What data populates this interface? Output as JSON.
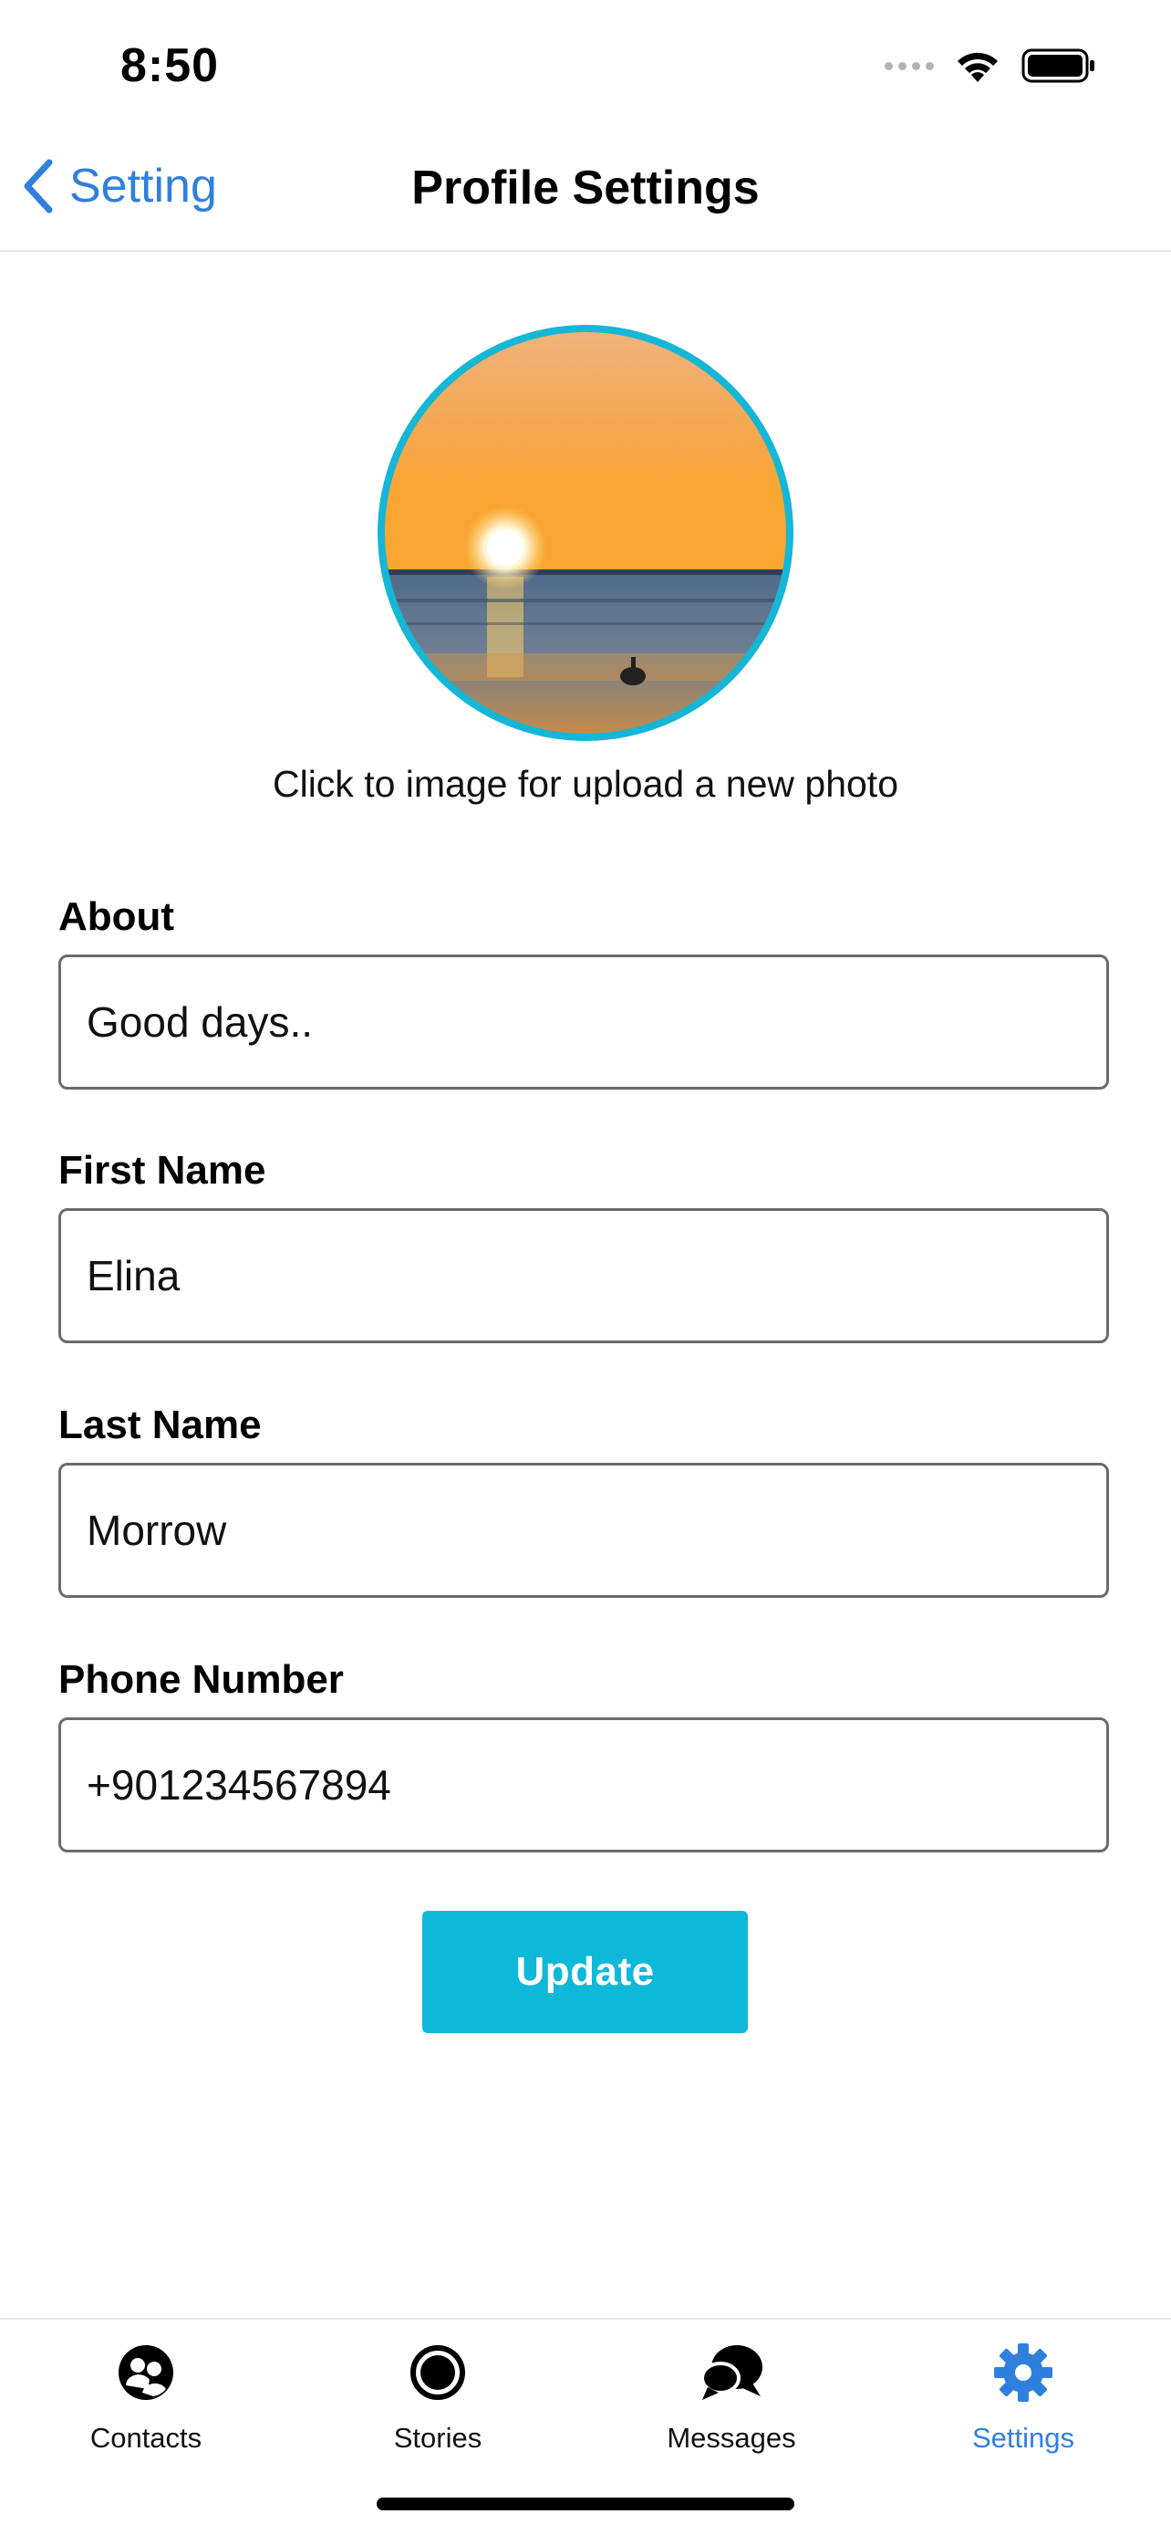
{
  "status_bar": {
    "time": "8:50"
  },
  "nav": {
    "back_label": "Setting",
    "title": "Profile Settings"
  },
  "profile": {
    "photo_hint": "Click to image for upload a new photo"
  },
  "form": {
    "about": {
      "label": "About",
      "value": "Good days.."
    },
    "first_name": {
      "label": "First Name",
      "value": "Elina"
    },
    "last_name": {
      "label": "Last Name",
      "value": "Morrow"
    },
    "phone": {
      "label": "Phone Number",
      "value": "+901234567894"
    },
    "update_label": "Update"
  },
  "tabbar": {
    "items": [
      {
        "label": "Contacts",
        "icon": "contacts-icon",
        "active": false
      },
      {
        "label": "Stories",
        "icon": "stories-icon",
        "active": false
      },
      {
        "label": "Messages",
        "icon": "messages-icon",
        "active": false
      },
      {
        "label": "Settings",
        "icon": "gear-icon",
        "active": true
      }
    ]
  },
  "colors": {
    "accent_blue": "#2f80dd",
    "button_teal": "#0db8d8",
    "avatar_ring": "#15b6d6"
  }
}
